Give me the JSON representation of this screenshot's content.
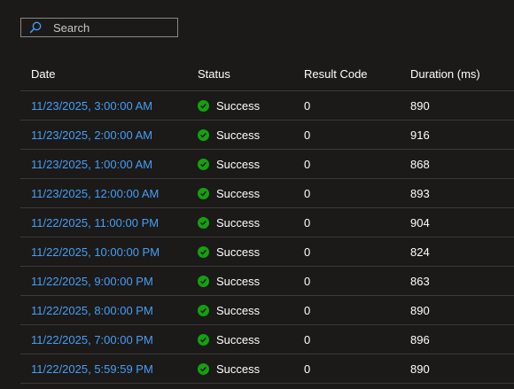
{
  "search": {
    "placeholder": "Search"
  },
  "columns": {
    "date": "Date",
    "status": "Status",
    "result_code": "Result Code",
    "duration": "Duration (ms)"
  },
  "colors": {
    "link": "#479ef5",
    "success": "#13a10e",
    "background": "#1b1a19"
  },
  "rows": [
    {
      "date": "11/23/2025, 3:00:00 AM",
      "status": "Success",
      "code": "0",
      "duration": "890"
    },
    {
      "date": "11/23/2025, 2:00:00 AM",
      "status": "Success",
      "code": "0",
      "duration": "916"
    },
    {
      "date": "11/23/2025, 1:00:00 AM",
      "status": "Success",
      "code": "0",
      "duration": "868"
    },
    {
      "date": "11/23/2025, 12:00:00 AM",
      "status": "Success",
      "code": "0",
      "duration": "893"
    },
    {
      "date": "11/22/2025, 11:00:00 PM",
      "status": "Success",
      "code": "0",
      "duration": "904"
    },
    {
      "date": "11/22/2025, 10:00:00 PM",
      "status": "Success",
      "code": "0",
      "duration": "824"
    },
    {
      "date": "11/22/2025, 9:00:00 PM",
      "status": "Success",
      "code": "0",
      "duration": "863"
    },
    {
      "date": "11/22/2025, 8:00:00 PM",
      "status": "Success",
      "code": "0",
      "duration": "890"
    },
    {
      "date": "11/22/2025, 7:00:00 PM",
      "status": "Success",
      "code": "0",
      "duration": "896"
    },
    {
      "date": "11/22/2025, 5:59:59 PM",
      "status": "Success",
      "code": "0",
      "duration": "890"
    }
  ]
}
